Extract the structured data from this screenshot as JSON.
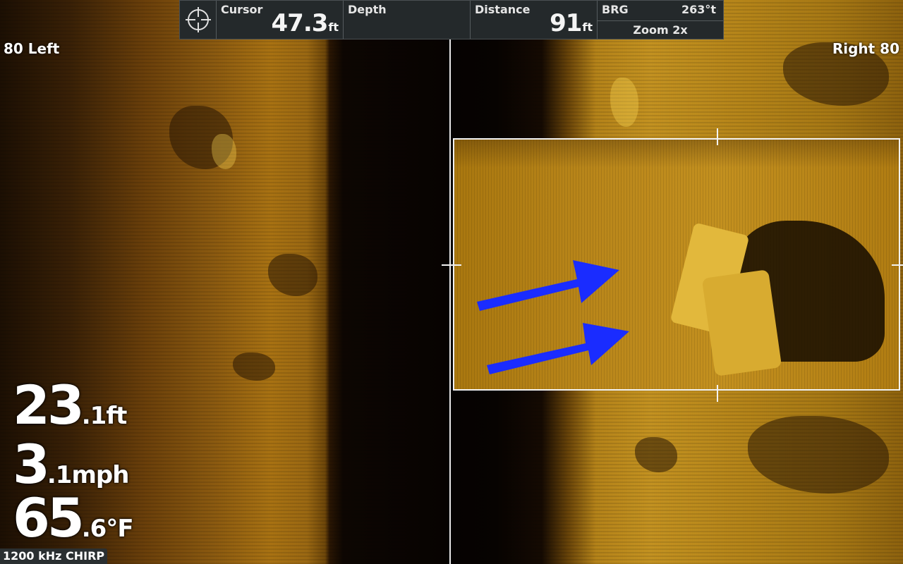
{
  "databar": {
    "cursor": {
      "label": "Cursor",
      "value": "47.3",
      "unit": "ft"
    },
    "depth": {
      "label": "Depth"
    },
    "distance": {
      "label": "Distance",
      "value": "91",
      "unit": "ft"
    },
    "bearing": {
      "label": "BRG",
      "value": "263°t"
    },
    "zoom_label": "Zoom 2x",
    "icon": "crosshair-icon"
  },
  "range": {
    "left": "80 Left",
    "right": "Right 80"
  },
  "readouts": {
    "depth": {
      "whole": "23",
      "fraction": ".1",
      "unit": "ft"
    },
    "speed": {
      "whole": "3",
      "fraction": ".1",
      "unit": "mph"
    },
    "temperature": {
      "whole": "65",
      "fraction": ".6",
      "unit": "°F"
    }
  },
  "frequency": "1200 kHz CHIRP",
  "colors": {
    "sonar_gold": "#c3901f",
    "marker_arrow": "#1a2cff",
    "databar_bg": "#24292b"
  }
}
